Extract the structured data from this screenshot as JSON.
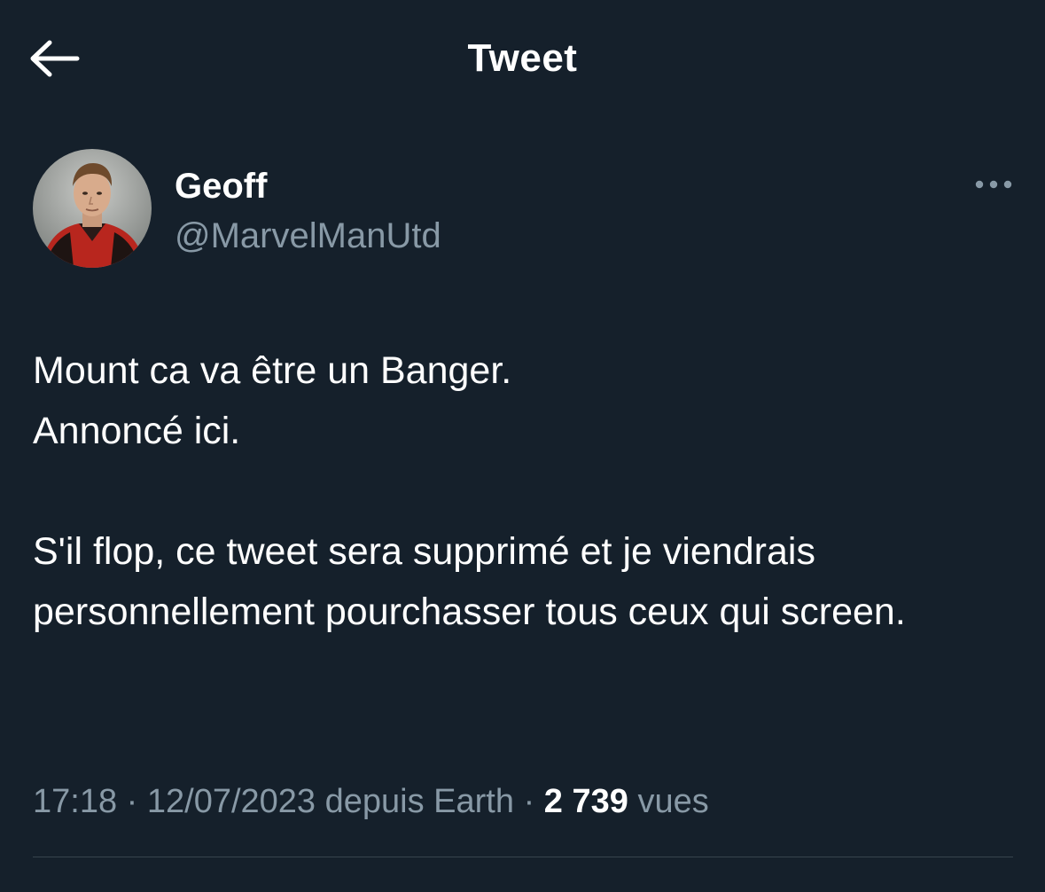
{
  "header": {
    "title": "Tweet",
    "back_icon": "arrow-left-icon"
  },
  "author": {
    "display_name": "Geoff",
    "handle": "@MarvelManUtd",
    "more_icon": "more-horizontal-icon"
  },
  "tweet": {
    "paragraphs": [
      [
        "Mount ca va être un Banger.",
        "Annoncé ici."
      ],
      [
        "S'il flop, ce tweet sera supprimé et je viendrais personnellement pourchasser tous ceux qui screen."
      ]
    ]
  },
  "meta": {
    "time": "17:18",
    "separator": "·",
    "date": "12/07/2023",
    "source": "depuis Earth",
    "views_count": "2 739",
    "views_label": "vues"
  },
  "colors": {
    "background": "#15202b",
    "text_primary": "#ffffff",
    "text_secondary": "#8899a6",
    "divider": "#38444d"
  }
}
